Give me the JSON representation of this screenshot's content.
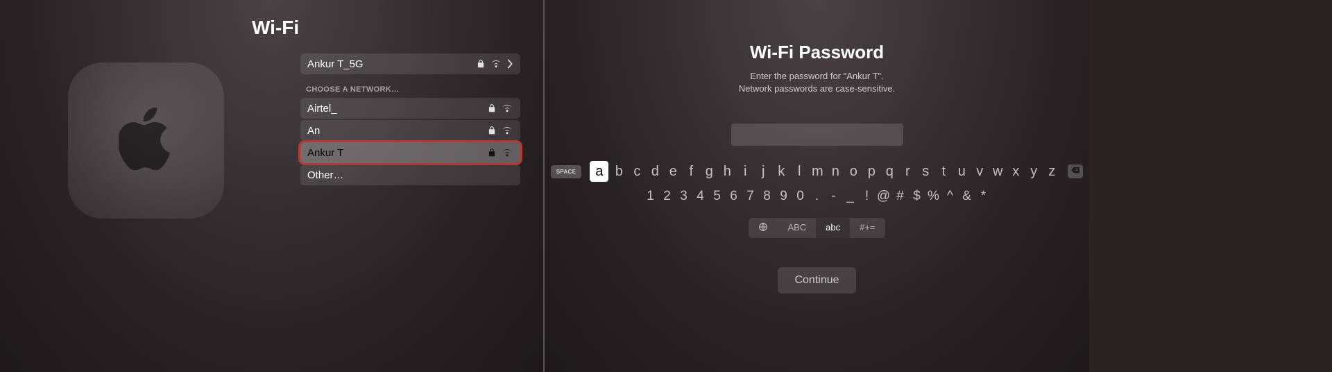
{
  "left": {
    "title": "Wi-Fi",
    "current": {
      "name": "Ankur T_5G"
    },
    "section_label": "CHOOSE A NETWORK…",
    "networks": [
      {
        "name": "Airtel_"
      },
      {
        "name": "An"
      },
      {
        "name": "Ankur T"
      }
    ],
    "other_label": "Other…"
  },
  "right": {
    "title": "Wi-Fi Password",
    "subtitle_line1": "Enter the password for \"Ankur T\".",
    "subtitle_line2": "Network passwords are case-sensitive.",
    "space_label": "SPACE",
    "row1": [
      "a",
      "b",
      "c",
      "d",
      "e",
      "f",
      "g",
      "h",
      "i",
      "j",
      "k",
      "l",
      "m",
      "n",
      "o",
      "p",
      "q",
      "r",
      "s",
      "t",
      "u",
      "v",
      "w",
      "x",
      "y",
      "z"
    ],
    "row2": [
      "1",
      "2",
      "3",
      "4",
      "5",
      "6",
      "7",
      "8",
      "9",
      "0",
      ".",
      "-",
      "_",
      "!",
      "@",
      "#",
      "$",
      "%",
      "^",
      "&",
      "*"
    ],
    "modes": {
      "abc_upper": "ABC",
      "abc_lower": "abc",
      "symbols": "#+="
    },
    "continue_label": "Continue"
  }
}
